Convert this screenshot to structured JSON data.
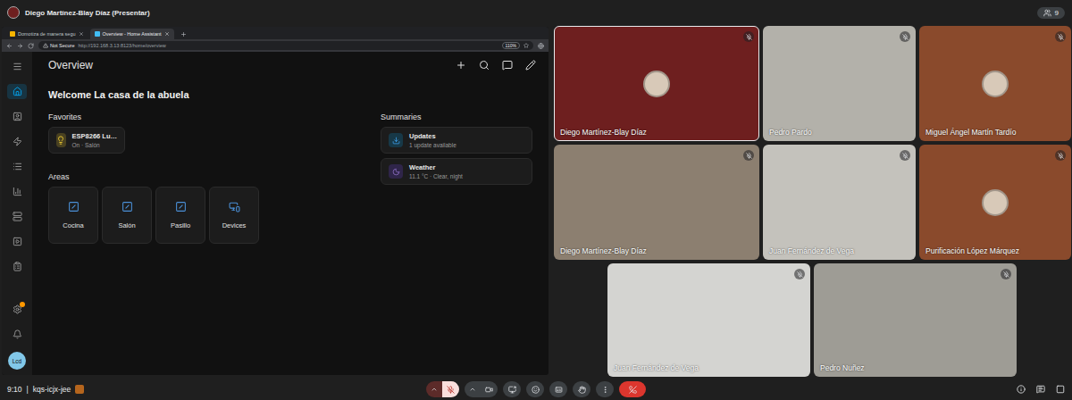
{
  "top_bar": {
    "presenter": "Diego Martínez-Blay Díaz (Presentar)",
    "participant_count": "9"
  },
  "browser": {
    "tabs": [
      {
        "label": "Domotiza de manera segu",
        "selected": false
      },
      {
        "label": "Overview - Home Assistant",
        "selected": true
      }
    ],
    "security_label": "Not Secure",
    "url": "http://192.168.3.13:8123/home/overview",
    "zoom": "110%"
  },
  "home_assistant": {
    "title": "Overview",
    "welcome": "Welcome La casa de la abuela",
    "sidebar": {
      "items": [
        {
          "selected": true
        },
        {
          "selected": false
        },
        {
          "selected": false
        },
        {
          "selected": false
        },
        {
          "selected": false
        },
        {
          "selected": false
        },
        {
          "selected": false
        },
        {
          "selected": false
        }
      ],
      "settings_badge": true,
      "user": "Lcd"
    },
    "favorites": {
      "heading": "Favorites",
      "items": [
        {
          "name": "ESP8266 Lu…",
          "state": "On · Salón",
          "on": true
        }
      ]
    },
    "areas": {
      "heading": "Areas",
      "items": [
        {
          "name": "Cocina",
          "kind": "area"
        },
        {
          "name": "Salón",
          "kind": "area"
        },
        {
          "name": "Pasillo",
          "kind": "area"
        },
        {
          "name": "Devices",
          "kind": "devices"
        }
      ]
    },
    "summaries": {
      "heading": "Summaries",
      "items": [
        {
          "title": "Updates",
          "detail": "1 update available",
          "kind": "updates"
        },
        {
          "title": "Weather",
          "detail": "11.1 °C · Clear, night",
          "kind": "weather"
        }
      ]
    }
  },
  "participants": [
    {
      "name": "Diego Martínez-Blay Díaz",
      "kind": "avatar",
      "muted": true,
      "highlighted": true,
      "color": "#6e1f1f"
    },
    {
      "name": "Pedro Pardo",
      "kind": "video",
      "muted": true,
      "highlighted": false,
      "color": "#b3b1aa"
    },
    {
      "name": "Miguel Ángel Martín Tardío",
      "kind": "avatar",
      "muted": true,
      "highlighted": false,
      "color": "#8a4a2c"
    },
    {
      "name": "Diego Martínez-Blay Díaz",
      "kind": "video",
      "muted": true,
      "highlighted": false,
      "color": "#8c7f70"
    },
    {
      "name": "Juan Fernández de Vega",
      "kind": "video",
      "muted": true,
      "highlighted": false,
      "color": "#c4c2bc"
    },
    {
      "name": "Purificación López Márquez",
      "kind": "avatar",
      "muted": true,
      "highlighted": false,
      "color": "#8a4a2c"
    },
    {
      "name": "Juan Fernández de Vega",
      "kind": "video",
      "muted": true,
      "highlighted": false,
      "color": "#d4d4d1"
    },
    {
      "name": "Pedro Nuñez",
      "kind": "video",
      "muted": true,
      "highlighted": false,
      "color": "#9e9c95"
    }
  ],
  "bottom_bar": {
    "time": "9:10",
    "separator": "|",
    "meeting_code": "kqs-icjx-jee",
    "mic_muted": true
  }
}
